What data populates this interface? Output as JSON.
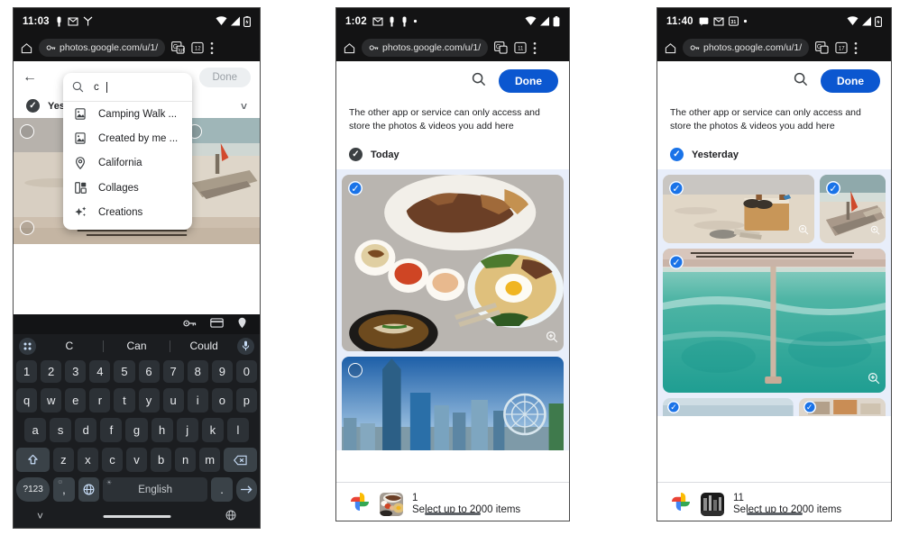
{
  "panels": [
    {
      "id": "panel-search",
      "status": {
        "time": "11:03",
        "icons": [
          "vpn-key-icon",
          "gmail-icon",
          "signal-tower-icon"
        ],
        "right": [
          "wifi-icon",
          "cell-signal-icon",
          "battery-icon"
        ]
      },
      "chrome": {
        "home_icon": "home-icon",
        "lock_icon": "site-settings-icon",
        "url": "photos.google.com/u/1/",
        "translate_icon": "translate-icon",
        "calendar_icon": "calendar-icon",
        "menu_icon": "overflow-menu-icon"
      },
      "header": {
        "back_label": "←",
        "done_label": "Done",
        "done_enabled": false
      },
      "search": {
        "icon": "search-icon",
        "value": "c",
        "suggestions": [
          {
            "icon": "photo-frame-icon",
            "label": "Camping Walk ..."
          },
          {
            "icon": "photo-frame-icon",
            "label": "Created by me ..."
          },
          {
            "icon": "location-pin-icon",
            "label": "California"
          },
          {
            "icon": "collage-icon",
            "label": "Collages"
          },
          {
            "icon": "sparkle-icon",
            "label": "Creations"
          }
        ]
      },
      "section": {
        "check_state": "dark",
        "label": "Yesterday",
        "chevron": "chevron-down-icon"
      },
      "keyboard": {
        "tools": [
          "password-key-icon",
          "card-icon",
          "location-pin-icon"
        ],
        "suggestions": [
          "C",
          "Can",
          "Could"
        ],
        "grid_icon": "keyboard-grid-icon",
        "mic_icon": "microphone-icon",
        "row_numbers": [
          "1",
          "2",
          "3",
          "4",
          "5",
          "6",
          "7",
          "8",
          "9",
          "0"
        ],
        "row_top": [
          "q",
          "w",
          "e",
          "r",
          "t",
          "y",
          "u",
          "i",
          "o",
          "p"
        ],
        "row_home": [
          "a",
          "s",
          "d",
          "f",
          "g",
          "h",
          "j",
          "k",
          "l"
        ],
        "row_bottom": [
          "z",
          "x",
          "c",
          "v",
          "b",
          "n",
          "m"
        ],
        "shift_icon": "shift-icon",
        "backspace_icon": "backspace-icon",
        "symbols_label": "?123",
        "comma_label": ",",
        "comma_sup": "☺",
        "globe_icon": "globe-icon",
        "space_label": "English",
        "space_sup": "🌐",
        "period_label": ".",
        "enter_icon": "enter-arrow-icon",
        "nav_collapse_icon": "chevron-down-icon",
        "nav_globe_icon": "globe-icon"
      }
    },
    {
      "id": "panel-today",
      "status": {
        "time": "1:02",
        "icons": [
          "gmail-icon",
          "vpn-key-icon",
          "vpn-key-icon",
          "dot-icon"
        ],
        "right": [
          "wifi-icon",
          "cell-signal-icon",
          "battery-icon"
        ]
      },
      "chrome": {
        "url": "photos.google.com/u/1/"
      },
      "header": {
        "search_icon": "search-icon",
        "done_label": "Done",
        "done_enabled": true
      },
      "notice": "The other app or service can only access and store the photos & videos you add here",
      "section": {
        "check_state": "dark",
        "label": "Today"
      },
      "tiles": [
        {
          "name": "korean-food-platter",
          "selected": true
        },
        {
          "name": "city-skyline-ferris-wheel",
          "selected": false
        }
      ],
      "bottom": {
        "logo": "google-photos-logo",
        "thumb": "korean-food-thumb",
        "count": "1",
        "subtitle": "Select up to 2000 items"
      }
    },
    {
      "id": "panel-yesterday",
      "status": {
        "time": "11:40",
        "icons": [
          "chat-icon",
          "gmail-icon",
          "calendar-icon",
          "dot-icon"
        ],
        "right": [
          "wifi-icon",
          "cell-signal-icon",
          "battery-icon"
        ]
      },
      "chrome": {
        "url": "photos.google.com/u/1/"
      },
      "header": {
        "search_icon": "search-icon",
        "done_label": "Done",
        "done_enabled": true
      },
      "notice": "The other app or service can only access and store the photos & videos you add here",
      "section": {
        "check_state": "blue",
        "label": "Yesterday"
      },
      "tiles": [
        {
          "name": "beach-bag-sandals",
          "selected": true
        },
        {
          "name": "beach-driftwood",
          "selected": true
        },
        {
          "name": "aerial-turquoise-pier",
          "selected": true
        },
        {
          "name": "beach-partial-bottom-left",
          "selected": true
        },
        {
          "name": "food-partial-bottom-right",
          "selected": true
        }
      ],
      "bottom": {
        "logo": "google-photos-logo",
        "thumb": "dark-photo-thumb",
        "count": "11",
        "subtitle": "Select up to 2000 items"
      }
    }
  ],
  "colors": {
    "accent_blue": "#0b57d0",
    "check_blue": "#1a73e8",
    "grid_bg": "#e8eefa",
    "status_bg": "#131314",
    "keyboard_bg": "#1b1d20",
    "key_bg": "#2c3136"
  }
}
